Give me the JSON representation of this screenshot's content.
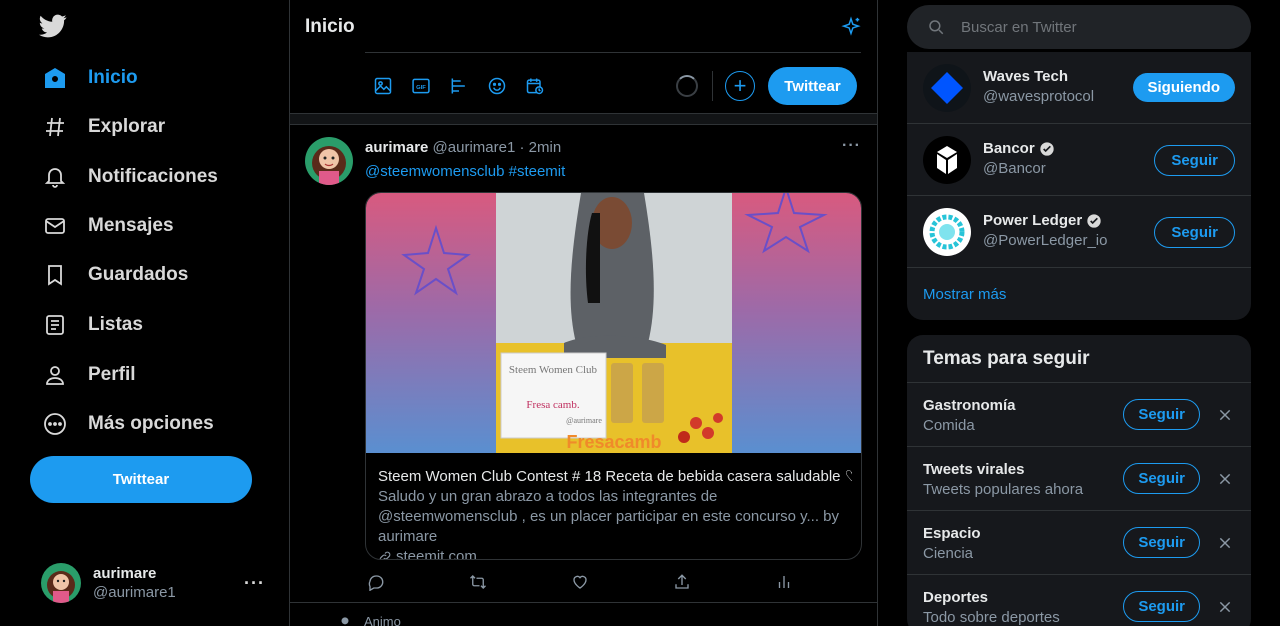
{
  "colors": {
    "accent": "#1d9bf0",
    "background": "#000000",
    "panel": "#16181c",
    "muted": "#8b98a5"
  },
  "sidebar": {
    "logo_icon": "twitter-bird-icon",
    "items": [
      {
        "label": "Inicio",
        "icon": "home-icon",
        "active": true
      },
      {
        "label": "Explorar",
        "icon": "hashtag-icon"
      },
      {
        "label": "Notificaciones",
        "icon": "bell-icon"
      },
      {
        "label": "Mensajes",
        "icon": "envelope-icon"
      },
      {
        "label": "Guardados",
        "icon": "bookmark-icon"
      },
      {
        "label": "Listas",
        "icon": "list-icon"
      },
      {
        "label": "Perfil",
        "icon": "person-icon"
      },
      {
        "label": "Más opciones",
        "icon": "more-circle-icon"
      }
    ],
    "tweet_button": "Twittear",
    "account": {
      "name": "aurimare",
      "handle": "@aurimare1",
      "more": "···"
    }
  },
  "main": {
    "title": "Inicio",
    "composer": {
      "tweet_button": "Twittear",
      "plus": "+"
    },
    "tweet": {
      "name": "aurimare",
      "handle": "@aurimare1",
      "separator": " · ",
      "time": "2min",
      "more": "···",
      "text": "@steemwomensclub #steemit",
      "card": {
        "title": "Steem Women Club Contest # 18 Receta de bebida casera saludable ♡...",
        "description": "Saludo y un gran abrazo a todos las integrantes de @steemwomensclub , es un placer participar en este concurso y... by aurimare",
        "url": "steemit.com",
        "image_caption_top": "Steem Women Club",
        "image_caption_mid": "Fresa camb.",
        "image_caption_tag": "@aurimare",
        "image_overlay": "Fresacamb"
      }
    },
    "next_tweet_label": "Animo"
  },
  "right": {
    "search_placeholder": "Buscar en Twitter",
    "follow": [
      {
        "name": "Waves Tech",
        "handle": "@wavesprotocol",
        "verified": false,
        "button": "Siguiendo"
      },
      {
        "name": "Bancor",
        "handle": "@Bancor",
        "verified": true,
        "button": "Seguir"
      },
      {
        "name": "Power Ledger",
        "handle": "@PowerLedger_io",
        "verified": true,
        "button": "Seguir"
      }
    ],
    "show_more": "Mostrar más",
    "topics_title": "Temas para seguir",
    "topics": [
      {
        "name": "Gastronomía",
        "sub": "Comida",
        "button": "Seguir"
      },
      {
        "name": "Tweets virales",
        "sub": "Tweets populares ahora",
        "button": "Seguir"
      },
      {
        "name": "Espacio",
        "sub": "Ciencia",
        "button": "Seguir"
      },
      {
        "name": "Deportes",
        "sub": "Todo sobre deportes",
        "button": "Seguir"
      }
    ]
  }
}
